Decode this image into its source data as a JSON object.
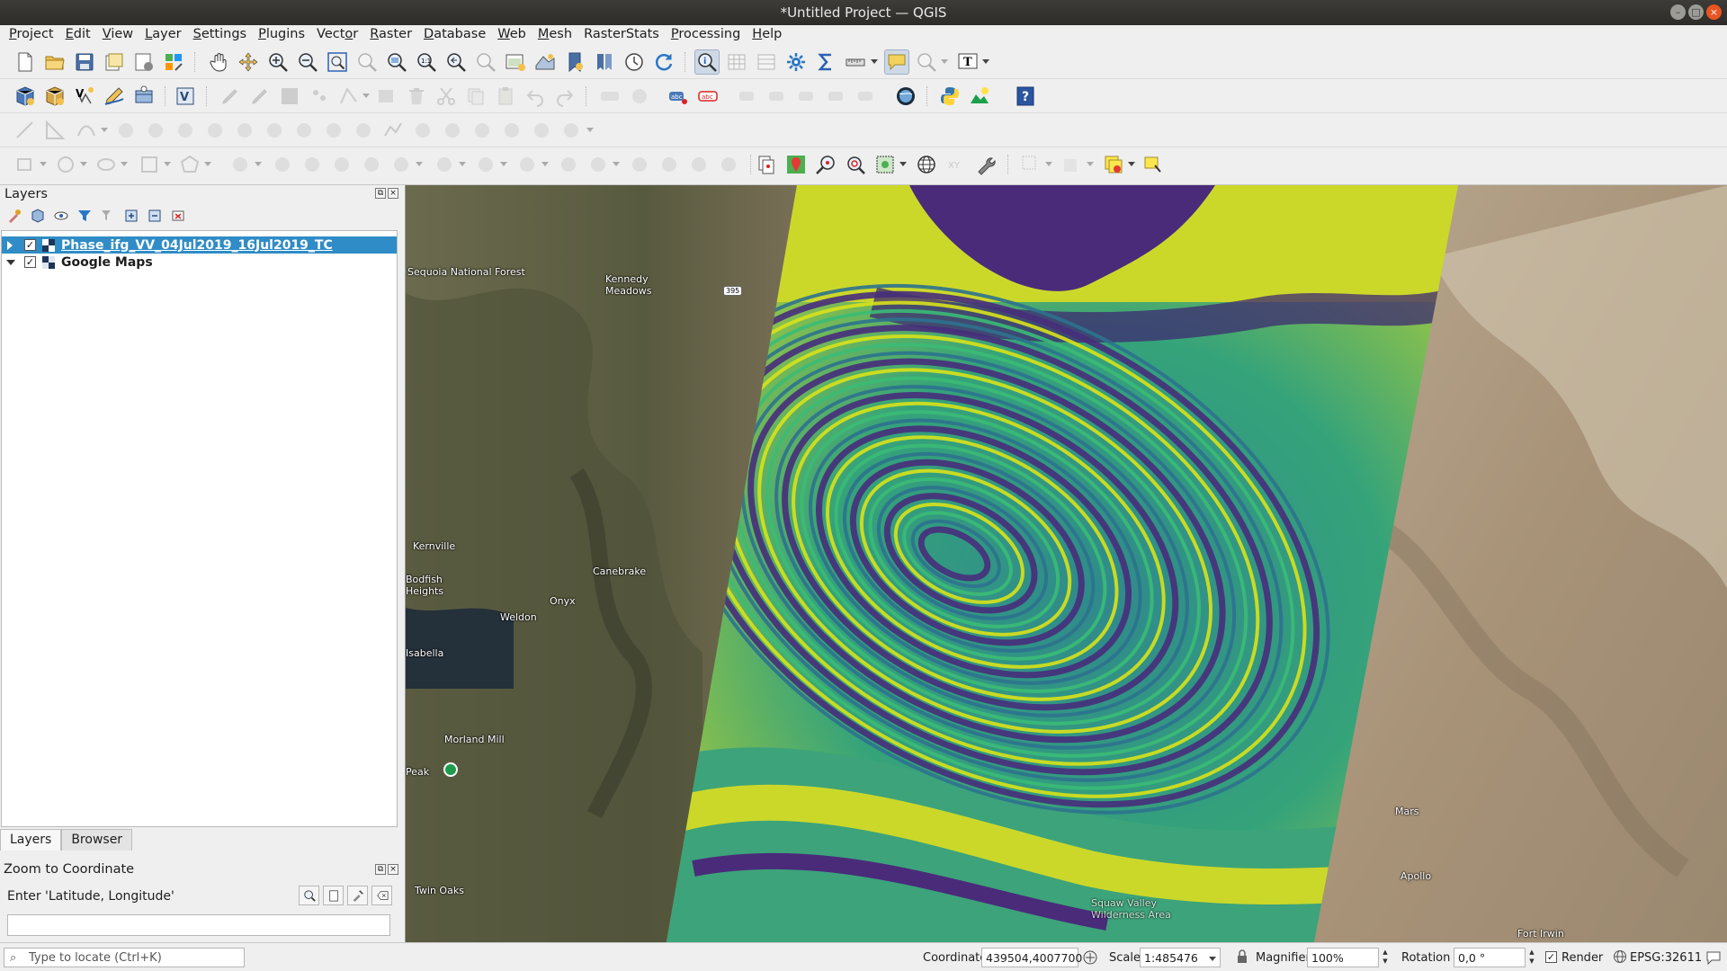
{
  "window": {
    "title": "*Untitled Project — QGIS",
    "controls": [
      "minimize",
      "maximize",
      "close"
    ]
  },
  "menubar": [
    {
      "label": "Project",
      "key": "P"
    },
    {
      "label": "Edit",
      "key": "E"
    },
    {
      "label": "View",
      "key": "V"
    },
    {
      "label": "Layer",
      "key": "L"
    },
    {
      "label": "Settings",
      "key": "S"
    },
    {
      "label": "Plugins",
      "key": "P"
    },
    {
      "label": "Vector",
      "key": "o"
    },
    {
      "label": "Raster",
      "key": "R"
    },
    {
      "label": "Database",
      "key": "D"
    },
    {
      "label": "Web",
      "key": "W"
    },
    {
      "label": "Mesh",
      "key": "M"
    },
    {
      "label": "RasterStats",
      "key": ""
    },
    {
      "label": "Processing",
      "key": "P"
    },
    {
      "label": "Help",
      "key": "H"
    }
  ],
  "layers_panel": {
    "title": "Layers",
    "layers": [
      {
        "name": "Phase_ifg_VV_04Jul2019_16Jul2019_TC",
        "checked": true,
        "selected": true,
        "expanded": false,
        "type": "raster"
      },
      {
        "name": "Google Maps",
        "checked": true,
        "selected": false,
        "expanded": true,
        "type": "raster"
      }
    ]
  },
  "tabs": [
    {
      "label": "Layers",
      "active": true
    },
    {
      "label": "Browser",
      "active": false
    }
  ],
  "zoom_to_coordinate": {
    "title": "Zoom to Coordinate",
    "label": "Enter 'Latitude, Longitude'",
    "value": ""
  },
  "map_labels": {
    "sequoia": "Sequoia National Forest",
    "kennedy": "Kennedy Meadows",
    "kernville": "Kernville",
    "lakeisabella": "Lake Isabella",
    "canebrake": "Canebrake",
    "onyx": "Onyx",
    "weldon": "Weldon",
    "bodfish": "Bodfish Heights",
    "isabella": "Isabella",
    "morland": "Morland Mill",
    "peak": "Peak",
    "twinoaks": "Twin Oaks",
    "mars": "Mars",
    "apollo": "Apollo",
    "fortirwin": "Fort Irwin",
    "hwy": "395",
    "squawvalley": "Squaw Valley Wilderness Area"
  },
  "statusbar": {
    "locator_placeholder": "Type to locate (Ctrl+K)",
    "coordinate_label": "Coordinate",
    "coordinate_value": "439504,4007700",
    "scale_label": "Scale",
    "scale_value": "1:485476",
    "magnifier_label": "Magnifier",
    "magnifier_value": "100%",
    "rotation_label": "Rotation",
    "rotation_value": "0,0 °",
    "render_label": "Render",
    "render_checked": true,
    "crs": "EPSG:32611"
  },
  "colors": {
    "selection": "#308cc6",
    "ifg_purple": "#472d7b",
    "ifg_blue": "#2c728e",
    "ifg_green": "#3bbb75",
    "ifg_yellow": "#d8e219"
  }
}
